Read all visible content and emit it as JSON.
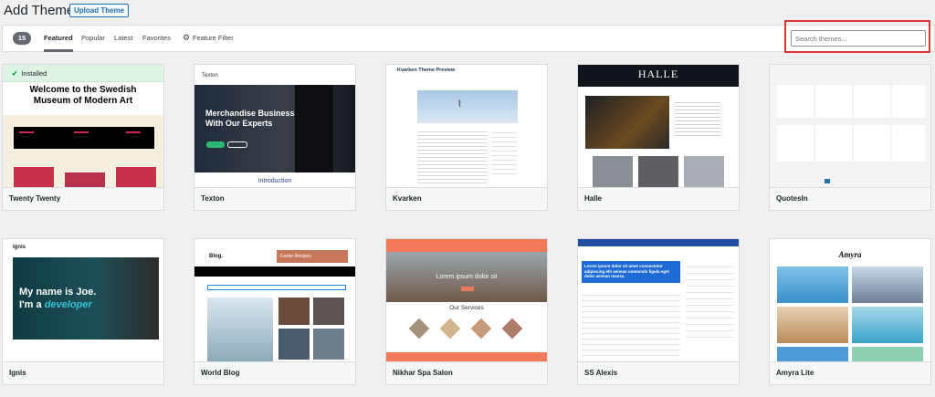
{
  "header": {
    "title": "Add Themes",
    "upload_label": "Upload Theme"
  },
  "filter": {
    "count": "15",
    "tabs": [
      "Featured",
      "Popular",
      "Latest",
      "Favorites"
    ],
    "feature_filter": "Feature Filter",
    "search_placeholder": "Search themes..."
  },
  "themes": [
    {
      "name": "Twenty Twenty",
      "installed": "Installed",
      "headline": "Welcome to the Swedish Museum of Modern Art"
    },
    {
      "name": "Texton",
      "logo": "Texton",
      "headline": "Merchandise Business With Our Experts",
      "section": "Introduction"
    },
    {
      "name": "Kvarken",
      "headline": "Kvarken Theme Preview"
    },
    {
      "name": "Halle",
      "logo": "HALLE"
    },
    {
      "name": "QuotesIn"
    },
    {
      "name": "Ignis",
      "logo": "Ignis",
      "line1": "My name is Joe.",
      "line2": "I'm a",
      "highlight": "developer"
    },
    {
      "name": "World Blog",
      "logo": "Blog.",
      "banner": "Faster Recipes"
    },
    {
      "name": "Nikhar Spa Salon",
      "headline": "Lorem ipsum dolor sit",
      "section": "Our Services"
    },
    {
      "name": "SS Alexis",
      "headline": "Lorem ipsum dolor sit amet consectetur adipiscing elit aenean commodo ligula eget dolor aenean massa."
    },
    {
      "name": "Amyra Lite",
      "logo": "Amyra"
    }
  ],
  "colors": {
    "accent": "#2271b1",
    "installed_bg": "#ddf3e3",
    "highlight": "#d63638"
  }
}
